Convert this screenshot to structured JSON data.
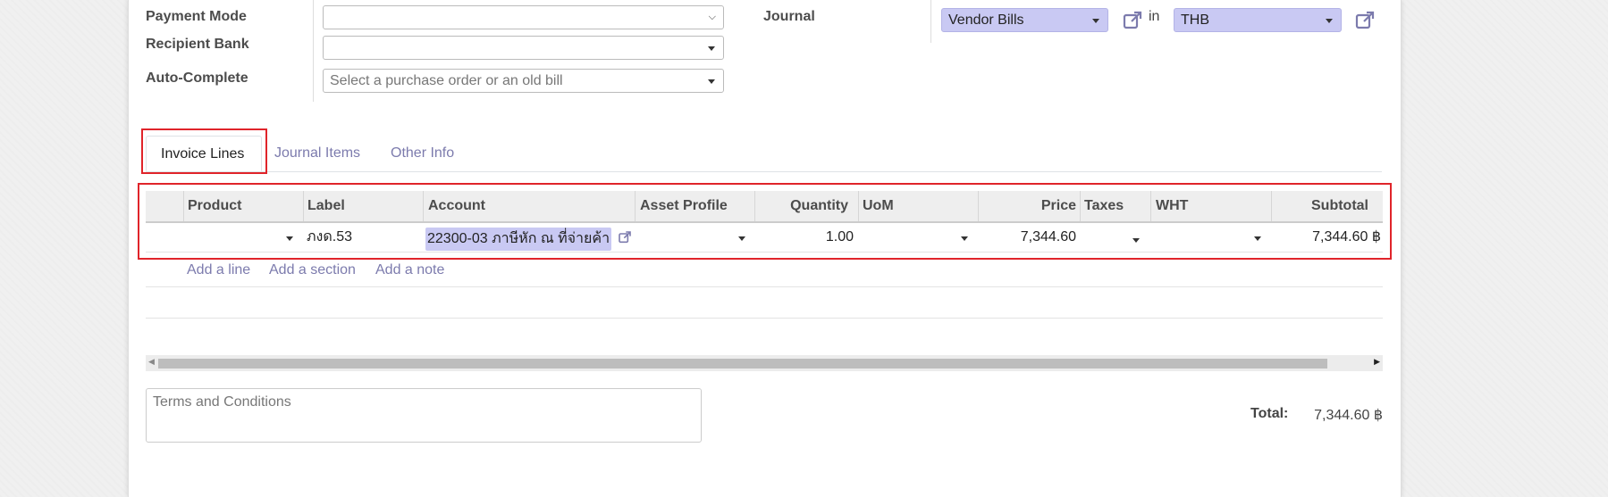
{
  "form": {
    "payment_mode_label": "Payment Mode",
    "payment_mode_value": "",
    "recipient_bank_label": "Recipient Bank",
    "recipient_bank_value": "",
    "auto_complete_label": "Auto-Complete",
    "auto_complete_placeholder": "Select a purchase order or an old bill",
    "journal_label": "Journal",
    "journal_value": "Vendor Bills",
    "in_label": "in",
    "currency_value": "THB"
  },
  "tabs": [
    {
      "label": "Invoice Lines",
      "active": true
    },
    {
      "label": "Journal Items",
      "active": false
    },
    {
      "label": "Other Info",
      "active": false
    }
  ],
  "table": {
    "headers": [
      "Product",
      "Label",
      "Account",
      "Asset Profile",
      "Quantity",
      "UoM",
      "Price",
      "Taxes",
      "WHT",
      "Subtotal"
    ],
    "row": {
      "product": "",
      "label": "ภงด.53",
      "account": "22300-03 ภาษีหัก ณ ที่จ่ายค้า",
      "asset_profile": "",
      "quantity": "1.00",
      "uom": "",
      "price": "7,344.60",
      "taxes": "",
      "wht": "",
      "subtotal": "7,344.60 ฿"
    },
    "actions": [
      "Add a line",
      "Add a section",
      "Add a note"
    ]
  },
  "terms_placeholder": "Terms and Conditions",
  "total": {
    "label": "Total:",
    "value": "7,344.60 ฿"
  },
  "colors": {
    "accent": "#7c7bad",
    "highlight": "#c9c9f3",
    "annotation_red": "#e0242a"
  }
}
